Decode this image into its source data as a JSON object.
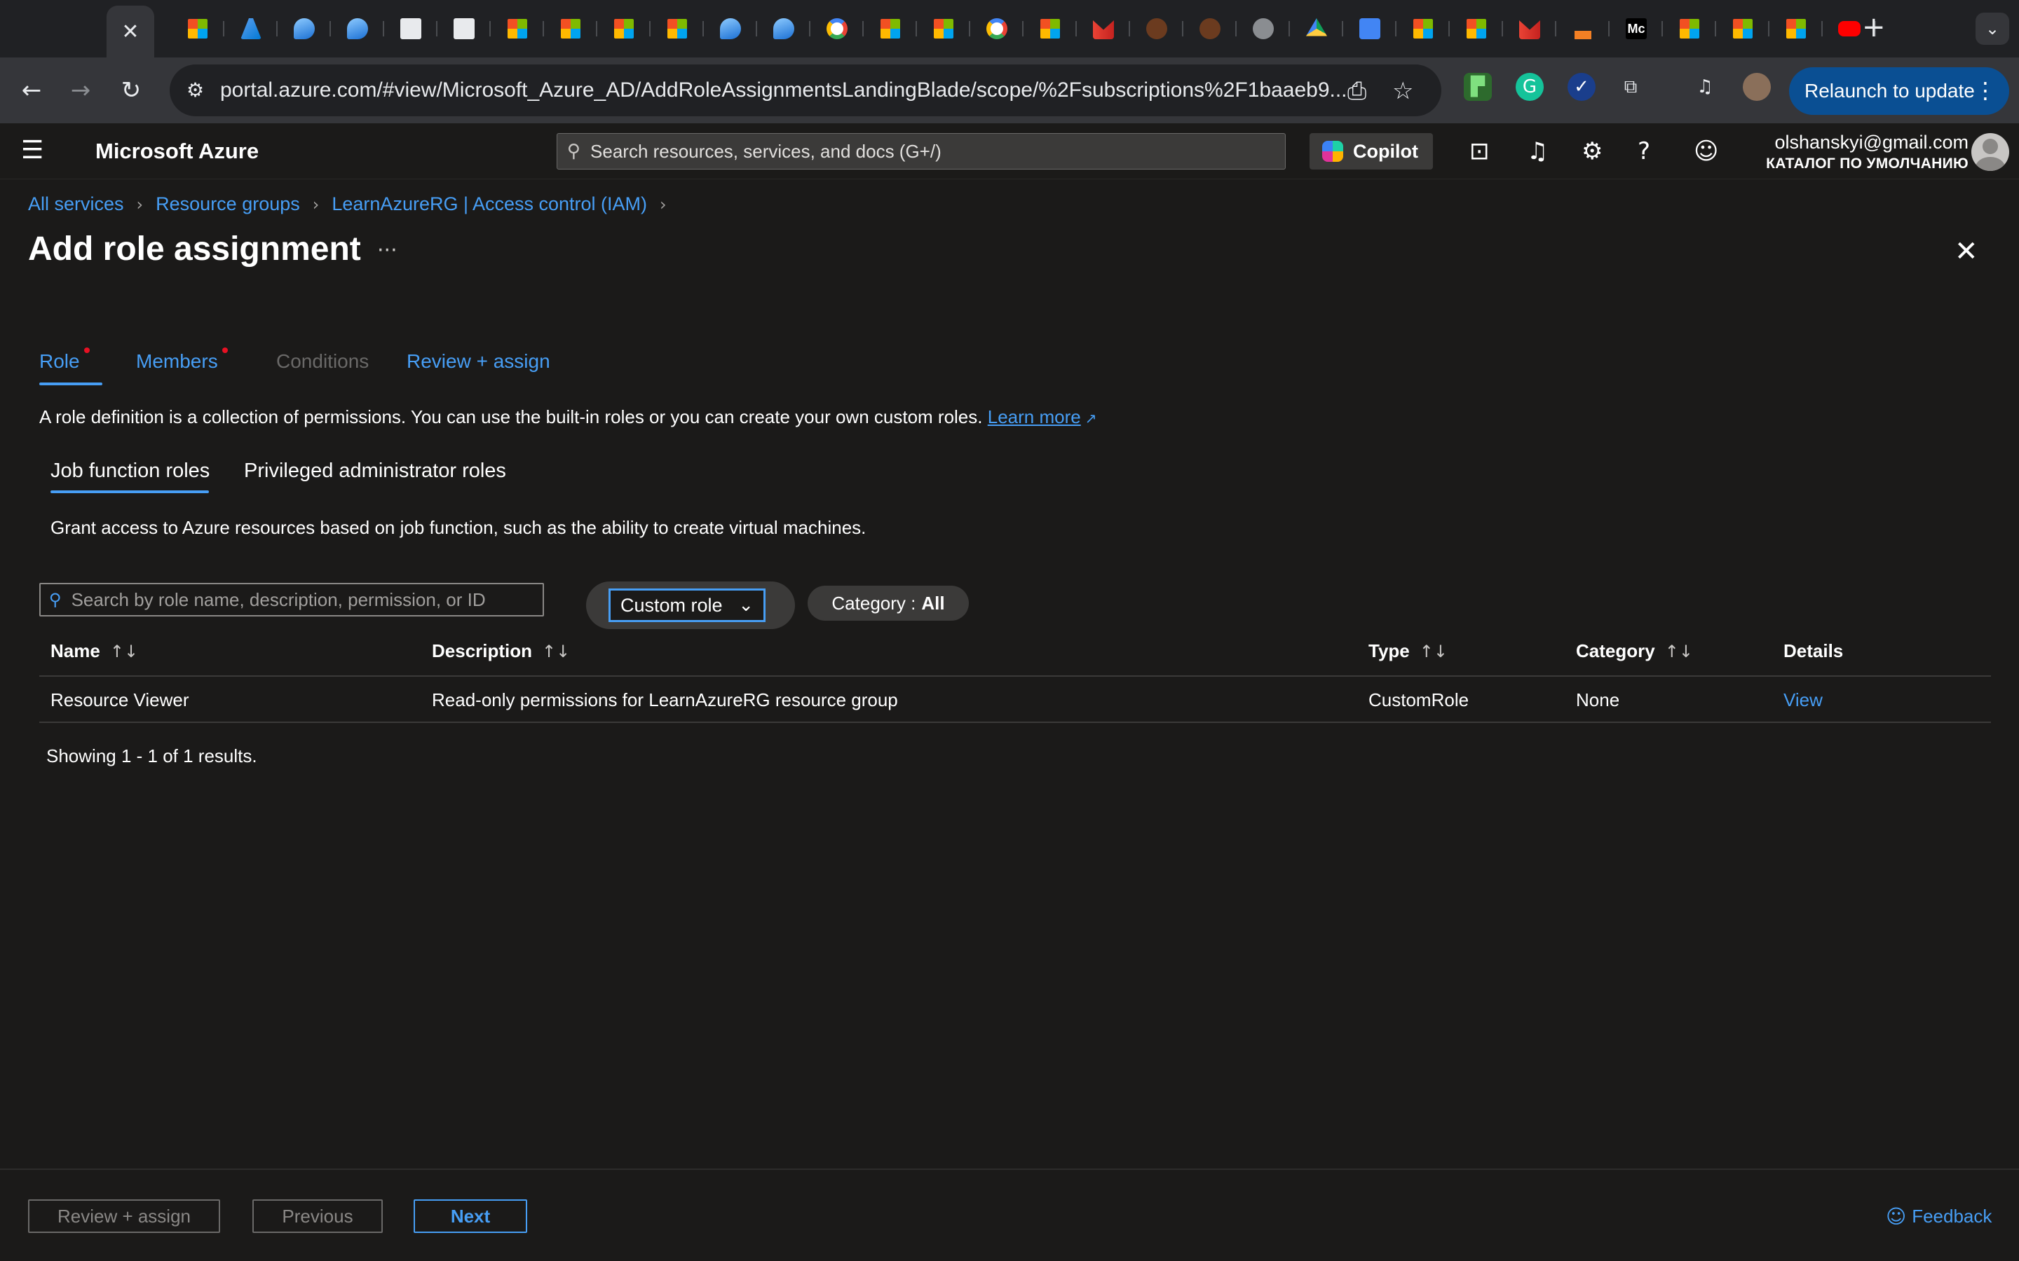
{
  "browser": {
    "active_tab_close": "✕",
    "tab_favicons": [
      "ms",
      "azure",
      "drop",
      "drop",
      "doc",
      "doc",
      "ms",
      "ms",
      "ms",
      "ms",
      "drop",
      "drop",
      "g",
      "ms",
      "ms",
      "g",
      "ms",
      "gm",
      "brown",
      "brown",
      "globe",
      "drive",
      "gdoc",
      "ms",
      "ms",
      "gm",
      "so",
      "mc",
      "ms",
      "ms",
      "ms",
      "yt"
    ],
    "new_tab": "+",
    "tab_search": "⌄",
    "url": "portal.azure.com/#view/Microsoft_Azure_AD/AddRoleAssignmentsLandingBlade/scope/%2Fsubscriptions%2F1baaeb9...",
    "relaunch_label": "Relaunch to update"
  },
  "azure": {
    "brand": "Microsoft Azure",
    "search_placeholder": "Search resources, services, and docs (G+/)",
    "copilot_label": "Copilot",
    "account_email": "olshanskyi@gmail.com",
    "account_directory": "КАТАЛОГ ПО УМОЛЧАНИЮ"
  },
  "breadcrumb": [
    "All services",
    "Resource groups",
    "LearnAzureRG | Access control (IAM)"
  ],
  "page": {
    "title": "Add role assignment",
    "more": "···"
  },
  "wizard_tabs": [
    {
      "label": "Role",
      "required": true,
      "state": "active"
    },
    {
      "label": "Members",
      "required": true,
      "state": "enabled"
    },
    {
      "label": "Conditions",
      "required": false,
      "state": "disabled"
    },
    {
      "label": "Review + assign",
      "required": false,
      "state": "enabled"
    }
  ],
  "role_description": "A role definition is a collection of permissions. You can use the built-in roles or you can create your own custom roles.",
  "learn_more": "Learn more",
  "role_tabs": [
    "Job function roles",
    "Privileged administrator roles"
  ],
  "grant_description": "Grant access to Azure resources based on job function, such as the ability to create virtual machines.",
  "filters": {
    "search_placeholder": "Search by role name, description, permission, or ID",
    "type_value": "Custom role",
    "category_label": "Category :",
    "category_value": "All"
  },
  "table": {
    "columns": [
      "Name",
      "Description",
      "Type",
      "Category",
      "Details"
    ],
    "rows": [
      {
        "name": "Resource Viewer",
        "description": "Read-only permissions for LearnAzureRG resource group",
        "type": "CustomRole",
        "category": "None",
        "details": "View"
      }
    ]
  },
  "results_text": "Showing 1 - 1 of 1 results.",
  "footer": {
    "review_assign": "Review + assign",
    "previous": "Previous",
    "next": "Next",
    "feedback": "Feedback"
  },
  "colors": {
    "background": "#1b1a19",
    "accent_link": "#479ef5",
    "required_dot": "#e81123",
    "relaunch_button": "#0a4f93"
  }
}
